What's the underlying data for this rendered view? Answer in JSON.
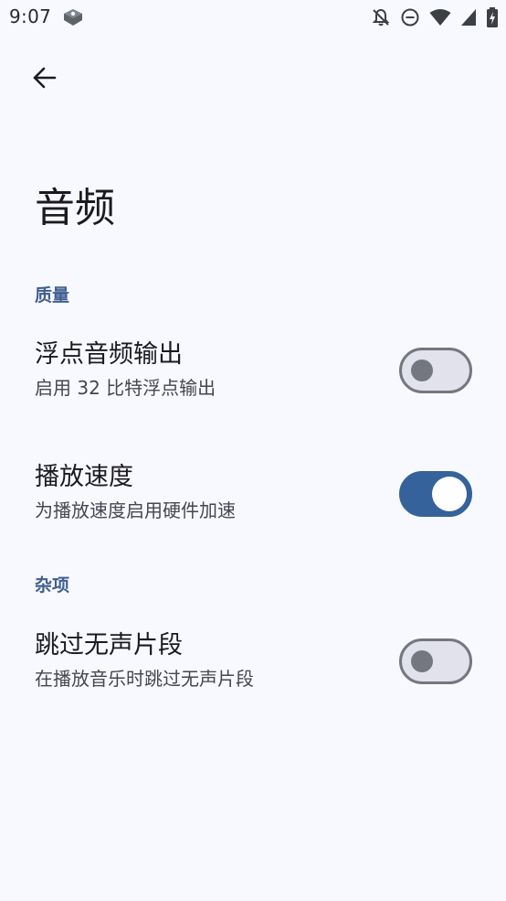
{
  "status_bar": {
    "time": "9:07",
    "icons": [
      "app-notification-icon",
      "do-not-disturb-bell-icon",
      "dnd-minus-icon",
      "wifi-icon",
      "cell-signal-icon",
      "battery-charging-icon"
    ]
  },
  "header": {
    "back_icon": "arrow-left-icon",
    "title": "音频"
  },
  "sections": [
    {
      "header": "质量",
      "items": [
        {
          "title": "浮点音频输出",
          "summary": "启用 32 比特浮点输出",
          "enabled": false
        },
        {
          "title": "播放速度",
          "summary": "为播放速度启用硬件加速",
          "enabled": true
        }
      ]
    },
    {
      "header": "杂项",
      "items": [
        {
          "title": "跳过无声片段",
          "summary": "在播放音乐时跳过无声片段",
          "enabled": false
        }
      ]
    }
  ],
  "colors": {
    "background": "#f8f9fe",
    "accent": "#35629a",
    "section_header": "#3f5f90",
    "switch_off_track": "#e1e2ec",
    "switch_off_outline": "#74777f"
  }
}
